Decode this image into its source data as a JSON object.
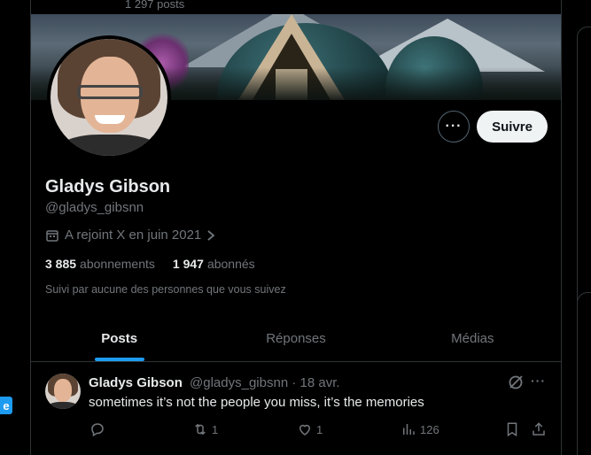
{
  "header": {
    "posts_count": "1 297 posts"
  },
  "profile": {
    "name": "Gladys Gibson",
    "handle": "@gladys_gibsnn",
    "joined": "A rejoint X en juin 2021",
    "following_count": "3 885",
    "following_label": "abonnements",
    "followers_count": "1 947",
    "followers_label": "abonnés",
    "followed_by": "Suivi par aucune des personnes que vous suivez"
  },
  "actions": {
    "more_label": "···",
    "follow_label": "Suivre"
  },
  "tabs": [
    {
      "label": "Posts",
      "active": true
    },
    {
      "label": "Réponses",
      "active": false
    },
    {
      "label": "Médias",
      "active": false
    }
  ],
  "tweet": {
    "author": "Gladys Gibson",
    "handle": "@gladys_gibsnn",
    "date": "· 18 avr.",
    "text": "sometimes it’s not the people you miss, it’s the memories",
    "more_label": "···",
    "retweets": "1",
    "likes": "1",
    "views": "126"
  },
  "left_badge": {
    "label": "e"
  },
  "colors": {
    "accent": "#1d9bf0",
    "background": "#000000",
    "muted": "#71767b"
  }
}
